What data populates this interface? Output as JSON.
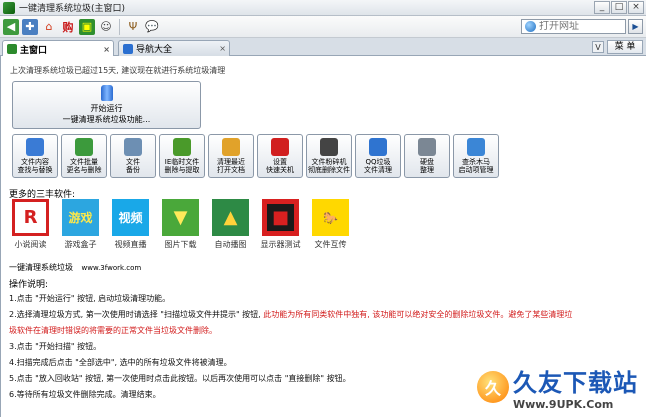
{
  "window": {
    "title": "一键清理系统垃圾(主窗口)",
    "controls": [
      "_",
      "□",
      "×"
    ]
  },
  "address": {
    "placeholder": "打开网址",
    "go": "▶"
  },
  "tabs": [
    {
      "label": "主窗口",
      "close": "×"
    },
    {
      "label": "导航大全",
      "close": "×"
    }
  ],
  "tab_chevron": "V",
  "menu_label": "菜 单",
  "notice": "上次清理系统垃圾已超过15天, 建议现在就进行系统垃圾清理",
  "start_button": {
    "line1": "开始运行",
    "line2": "一键清理系统垃圾功能..."
  },
  "tools": [
    {
      "line1": "文件内容",
      "line2": "查找与替换",
      "color": "#3a7bd5"
    },
    {
      "line1": "文件批量",
      "line2": "更名与删除",
      "color": "#3c9a3c"
    },
    {
      "line1": "文件",
      "line2": "备份",
      "color": "#6d8fb3"
    },
    {
      "line1": "IE临时文件",
      "line2": "删除与提取",
      "color": "#4a9a2a"
    },
    {
      "line1": "清理最近",
      "line2": "打开文档",
      "color": "#e1a22a"
    },
    {
      "line1": "设置",
      "line2": "快速关机",
      "color": "#d11f1f"
    },
    {
      "line1": "文件粉碎机",
      "line2": "彻底删除文件",
      "color": "#444444"
    },
    {
      "line1": "QQ垃圾",
      "line2": "文件清理",
      "color": "#2f74d0"
    },
    {
      "line1": "硬盘",
      "line2": "整理",
      "color": "#7b8794"
    },
    {
      "line1": "查杀木马",
      "line2": "启动项管理",
      "color": "#3b86d6"
    }
  ],
  "more_title": "更多的三丰软件:",
  "apps": [
    {
      "label": "小说阅读",
      "glyph": "R",
      "bg": "#ffffff",
      "fg": "#d42020"
    },
    {
      "label": "游戏盒子",
      "glyph": "游戏",
      "bg": "#2ca6e0",
      "fg": "#ffe94a"
    },
    {
      "label": "视频直播",
      "glyph": "视频",
      "bg": "#19a8e8",
      "fg": "#ffffff"
    },
    {
      "label": "图片下载",
      "glyph": "▼",
      "bg": "#4aa83a",
      "fg": "#ffea5a"
    },
    {
      "label": "自动播图",
      "glyph": "▲",
      "bg": "#2d8a45",
      "fg": "#ffd23a"
    },
    {
      "label": "显示器测试",
      "glyph": "■",
      "bg": "#1a1a1a",
      "fg": "#d82020"
    },
    {
      "label": "文件互传",
      "glyph": "🐎",
      "bg": "#ffd800",
      "fg": "#000000"
    }
  ],
  "footline": {
    "name": "一键清理系统垃圾",
    "site": "www.3fwork.com"
  },
  "instructions_title": "操作说明:",
  "instructions": [
    {
      "text": "1.点击 \"开始运行\" 按钮, 启动垃圾清理功能。",
      "red": ""
    },
    {
      "text": "2.选择清理垃圾方式, 第一次使用时请选择 \"扫描垃圾文件并提示\" 按钮, ",
      "red": "此功能为所有同类软件中独有, 该功能可以绝对安全的删除垃圾文件。避免了某些清理垃"
    },
    {
      "text": "",
      "red": "圾软件在清理时错误的将需要的正常文件当垃圾文件删除。"
    },
    {
      "text": "3.点击 \"开始扫描\" 按钮。",
      "red": ""
    },
    {
      "text": "4.扫描完成后点击 \"全部选中\", 选中的所有垃圾文件将被清理。",
      "red": ""
    },
    {
      "text": "5.点击 \"放入回收站\" 按钮, 第一次使用时点击此按钮。以后再次使用可以点击 \"直接删除\" 按钮。",
      "red": ""
    },
    {
      "text": "6.等待所有垃圾文件删除完成。清理结束。",
      "red": ""
    }
  ],
  "watermark": {
    "cn": "久友下载站",
    "en": "Www.9UPK.Com",
    "glyph": "久"
  }
}
